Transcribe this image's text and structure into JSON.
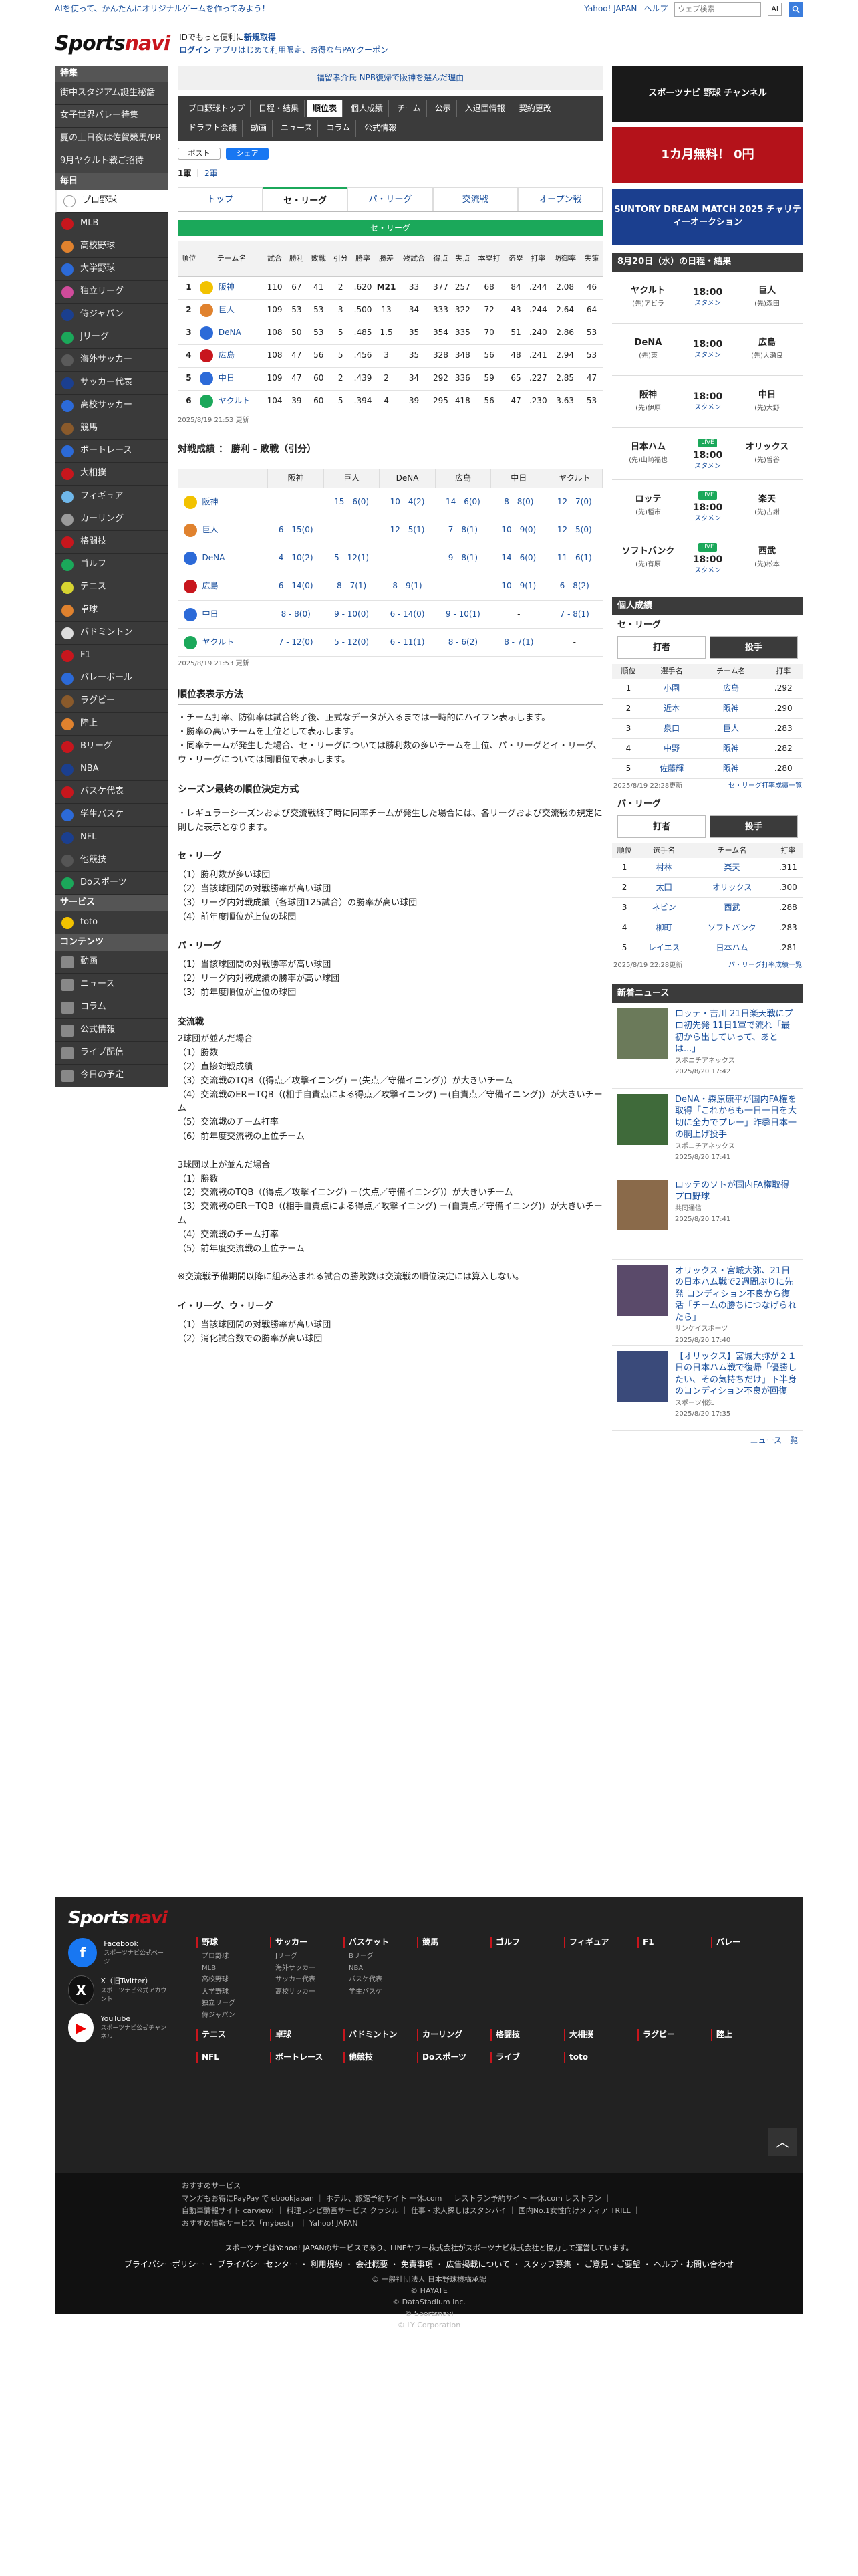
{
  "topbar": {
    "promo": "AIを使って、かんたんにオリジナルゲームを作ってみよう！",
    "links": [
      "Yahoo! JAPAN",
      "ヘルプ"
    ],
    "search_placeholder": "ウェブ検索",
    "search_label": "Ai"
  },
  "header": {
    "logo_a": "Sports",
    "logo_b": "navi",
    "line1a": "IDでもっと便利に",
    "line1b": "新規取得",
    "line2a": "ログイン",
    "line2b": "アプリはじめて利用限定、お得な与PAYクーポン"
  },
  "leftnav": {
    "feature_title": "特集",
    "features": [
      "街中スタジアム誕生秘話",
      "女子世界バレー特集",
      "夏の土日夜は佐賀競馬/PR",
      "9月ヤクルト戦ご招待"
    ],
    "daily_title": "毎日",
    "daily": [
      {
        "label": "プロ野球",
        "color": "#ffffff"
      },
      {
        "label": "MLB",
        "color": "#c8161d"
      },
      {
        "label": "高校野球",
        "color": "#e0822e"
      },
      {
        "label": "大学野球",
        "color": "#2c6ad8"
      },
      {
        "label": "独立リーグ",
        "color": "#d04b9b"
      },
      {
        "label": "侍ジャパン",
        "color": "#1b3f8f"
      },
      {
        "label": "Jリーグ",
        "color": "#1ba85a"
      },
      {
        "label": "海外サッカー",
        "color": "#5a5a5a"
      },
      {
        "label": "サッカー代表",
        "color": "#1b3f8f"
      },
      {
        "label": "高校サッカー",
        "color": "#2c6ad8"
      },
      {
        "label": "競馬",
        "color": "#8a5a2b"
      },
      {
        "label": "ボートレース",
        "color": "#2c6ad8"
      },
      {
        "label": "大相撲",
        "color": "#c8161d"
      },
      {
        "label": "フィギュア",
        "color": "#6fb7ea"
      },
      {
        "label": "カーリング",
        "color": "#9b9b9b"
      },
      {
        "label": "格闘技",
        "color": "#c8161d"
      },
      {
        "label": "ゴルフ",
        "color": "#1ba85a"
      },
      {
        "label": "テニス",
        "color": "#d7d431"
      },
      {
        "label": "卓球",
        "color": "#e0822e"
      },
      {
        "label": "バドミントン",
        "color": "#dddddd"
      },
      {
        "label": "F1",
        "color": "#c8161d"
      },
      {
        "label": "バレーボール",
        "color": "#2c6ad8"
      },
      {
        "label": "ラグビー",
        "color": "#8a5a2b"
      },
      {
        "label": "陸上",
        "color": "#e0822e"
      },
      {
        "label": "Bリーグ",
        "color": "#c8161d"
      },
      {
        "label": "NBA",
        "color": "#1b3f8f"
      },
      {
        "label": "バスケ代表",
        "color": "#c8161d"
      },
      {
        "label": "学生バスケ",
        "color": "#2c6ad8"
      },
      {
        "label": "NFL",
        "color": "#1b3f8f"
      },
      {
        "label": "他競技",
        "color": "#555555"
      },
      {
        "label": "Doスポーツ",
        "color": "#1ba85a"
      }
    ],
    "service_title": "サービス",
    "service": [
      "toto"
    ],
    "content_title": "コンテンツ",
    "content": [
      "動画",
      "ニュース",
      "コラム",
      "公式情報",
      "ライブ配信",
      "今日の予定"
    ]
  },
  "main": {
    "banner": "福留孝介氏 NPB復帰で阪神を選んだ理由",
    "menu": [
      "プロ野球トップ",
      "日程・結果",
      "順位表",
      "個人成績",
      "チーム",
      "公示",
      "入退団情報",
      "契約更改",
      "ドラフト会議",
      "動画",
      "ニュース",
      "コラム",
      "公式情報"
    ],
    "social_x": "ポスト",
    "social_fb": "シェア",
    "years_cur": "1軍",
    "years_other": "2軍",
    "tabs": [
      "トップ",
      "セ・リーグ",
      "パ・リーグ",
      "交流戦",
      "オープン戦"
    ],
    "league_label": "セ・リーグ",
    "stand_headers": [
      "順位",
      "チーム名",
      "試合",
      "勝利",
      "敗戦",
      "引分",
      "勝率",
      "勝差",
      "残試合",
      "得点",
      "失点",
      "本塁打",
      "盗塁",
      "打率",
      "防御率",
      "失策"
    ],
    "standings": [
      {
        "rank": "1",
        "team": "阪神",
        "color": "#f2c200",
        "vals": [
          "110",
          "67",
          "41",
          "2",
          ".620",
          "M21",
          "33",
          "377",
          "257",
          "68",
          "84",
          ".244",
          "2.08",
          "46"
        ]
      },
      {
        "rank": "2",
        "team": "巨人",
        "color": "#e0822e",
        "vals": [
          "109",
          "53",
          "53",
          "3",
          ".500",
          "13",
          "34",
          "333",
          "322",
          "72",
          "43",
          ".244",
          "2.64",
          "64"
        ]
      },
      {
        "rank": "3",
        "team": "DeNA",
        "color": "#2c6ad8",
        "vals": [
          "108",
          "50",
          "53",
          "5",
          ".485",
          "1.5",
          "35",
          "354",
          "335",
          "70",
          "51",
          ".240",
          "2.86",
          "53"
        ]
      },
      {
        "rank": "4",
        "team": "広島",
        "color": "#c8161d",
        "vals": [
          "108",
          "47",
          "56",
          "5",
          ".456",
          "3",
          "35",
          "328",
          "348",
          "56",
          "48",
          ".241",
          "2.94",
          "53"
        ]
      },
      {
        "rank": "5",
        "team": "中日",
        "color": "#2c6ad8",
        "vals": [
          "109",
          "47",
          "60",
          "2",
          ".439",
          "2",
          "34",
          "292",
          "336",
          "59",
          "65",
          ".227",
          "2.85",
          "47"
        ]
      },
      {
        "rank": "6",
        "team": "ヤクルト",
        "color": "#1ba85a",
        "vals": [
          "104",
          "39",
          "60",
          "5",
          ".394",
          "4",
          "39",
          "295",
          "418",
          "56",
          "47",
          ".230",
          "3.63",
          "53"
        ]
      }
    ],
    "updated1": "2025/8/19 21:53 更新",
    "vs_title": "対戦成績 ： 勝利 - 敗戦（引分）",
    "vs_headers": [
      "",
      "阪神",
      "巨人",
      "DeNA",
      "広島",
      "中日",
      "ヤクルト"
    ],
    "vs_rows": [
      {
        "team": "阪神",
        "color": "#f2c200",
        "vals": [
          "-",
          "15 - 6(0)",
          "10 - 4(2)",
          "14 - 6(0)",
          "8 - 8(0)",
          "12 - 7(0)"
        ]
      },
      {
        "team": "巨人",
        "color": "#e0822e",
        "vals": [
          "6 - 15(0)",
          "-",
          "12 - 5(1)",
          "7 - 8(1)",
          "10 - 9(0)",
          "12 - 5(0)"
        ]
      },
      {
        "team": "DeNA",
        "color": "#2c6ad8",
        "vals": [
          "4 - 10(2)",
          "5 - 12(1)",
          "-",
          "9 - 8(1)",
          "14 - 6(0)",
          "11 - 6(1)"
        ]
      },
      {
        "team": "広島",
        "color": "#c8161d",
        "vals": [
          "6 - 14(0)",
          "8 - 7(1)",
          "8 - 9(1)",
          "-",
          "10 - 9(1)",
          "6 - 8(2)"
        ]
      },
      {
        "team": "中日",
        "color": "#2c6ad8",
        "vals": [
          "8 - 8(0)",
          "9 - 10(0)",
          "6 - 14(0)",
          "9 - 10(1)",
          "-",
          "7 - 8(1)"
        ]
      },
      {
        "team": "ヤクルト",
        "color": "#1ba85a",
        "vals": [
          "7 - 12(0)",
          "5 - 12(0)",
          "6 - 11(1)",
          "8 - 6(2)",
          "8 - 7(1)",
          "-"
        ]
      }
    ],
    "updated2": "2025/8/19 21:53 更新",
    "rank_title": "順位表表示方法",
    "rank_text": [
      "・チーム打率、防御率は試合終了後、正式なデータが入るまでは一時的にハイフン表示します。",
      "・勝率の高いチームを上位として表示します。",
      "・同率チームが発生した場合、セ・リーグについては勝利数の多いチームを上位、パ・リーグとイ・リーグ、ウ・リーグについては同順位で表示します。"
    ],
    "season_title": "シーズン最終の順位決定方式",
    "season_text": "・レギュラーシーズンおよび交流戦終了時に同率チームが発生した場合には、各リーグおよび交流戦の規定に則した表示となります。",
    "ce_title": "セ・リーグ",
    "ce": [
      "（1）勝利数が多い球団",
      "（2）当該球団間の対戦勝率が高い球団",
      "（3）リーグ内対戦成績（各球団125試合）の勝率が高い球団",
      "（4）前年度順位が上位の球団"
    ],
    "pa_title": "パ・リーグ",
    "pa": [
      "（1）当該球団間の対戦勝率が高い球団",
      "（2）リーグ内対戦成績の勝率が高い球団",
      "（3）前年度順位が上位の球団"
    ],
    "kr_title": "交流戦",
    "kr1_title": "2球団が並んだ場合",
    "kr1": [
      "（1）勝数",
      "（2）直接対戦成績",
      "（3）交流戦のTQB（(得点／攻撃イニング) －(失点／守備イニング)）が大きいチーム",
      "（4）交流戦のER－TQB（(相手自責点による得点／攻撃イニング) －(自責点／守備イニング)）が大きいチーム",
      "（5）交流戦のチーム打率",
      "（6）前年度交流戦の上位チーム"
    ],
    "kr2_title": "3球団以上が並んだ場合",
    "kr2": [
      "（1）勝数",
      "（2）交流戦のTQB（(得点／攻撃イニング) －(失点／守備イニング)）が大きいチーム",
      "（3）交流戦のER－TQB（(相手自責点による得点／攻撃イニング) －(自責点／守備イニング)）が大きいチーム",
      "（4）交流戦のチーム打率",
      "（5）前年度交流戦の上位チーム"
    ],
    "kr_note": "※交流戦予備期間以降に組み込まれる試合の勝敗数は交流戦の順位決定には算入しない。",
    "iu_title": "イ・リーグ、ウ・リーグ",
    "iu": [
      "（1）当該球団間の対戦勝率が高い球団",
      "（2）消化試合数での勝率が高い球団"
    ]
  },
  "right": {
    "ad1": "スポーツナビ 野球 チャンネル",
    "ad2": "1カ月無料！ 0円",
    "ad3": "SUNTORY DREAM MATCH 2025 チャリティーオークション",
    "games_title": "8月20日（水）の日程・結果",
    "games": [
      {
        "h": "ヤクルト",
        "hp": "(先)アビラ",
        "a": "巨人",
        "ap": "(先)森田",
        "time": "18:00",
        "st": "スタメン",
        "live": false
      },
      {
        "h": "DeNA",
        "hp": "(先)東",
        "a": "広島",
        "ap": "(先)大瀬良",
        "time": "18:00",
        "st": "スタメン",
        "live": false
      },
      {
        "h": "阪神",
        "hp": "(先)伊原",
        "a": "中日",
        "ap": "(先)大野",
        "time": "18:00",
        "st": "スタメン",
        "live": false
      },
      {
        "h": "日本ハム",
        "hp": "(先)山崎福也",
        "a": "オリックス",
        "ap": "(先)曽谷",
        "time": "18:00",
        "st": "スタメン",
        "live": true
      },
      {
        "h": "ロッテ",
        "hp": "(先)種市",
        "a": "楽天",
        "ap": "(先)古謝",
        "time": "18:00",
        "st": "スタメン",
        "live": true
      },
      {
        "h": "ソフトバンク",
        "hp": "(先)有原",
        "a": "西武",
        "ap": "(先)松本",
        "time": "18:00",
        "st": "スタメン",
        "live": true
      }
    ],
    "ind_title": "個人成績",
    "ce_label": "セ・リーグ",
    "seg": [
      "打者",
      "投手"
    ],
    "ind_head": [
      "順位",
      "選手名",
      "チーム名",
      "打率"
    ],
    "ce_bat": [
      [
        "1",
        "小園",
        "広島",
        ".292"
      ],
      [
        "2",
        "近本",
        "阪神",
        ".290"
      ],
      [
        "3",
        "泉口",
        "巨人",
        ".283"
      ],
      [
        "4",
        "中野",
        "阪神",
        ".282"
      ],
      [
        "5",
        "佐藤輝",
        "阪神",
        ".280"
      ]
    ],
    "ce_upd": "2025/8/19 22:28更新",
    "ce_more": "セ・リーグ打率成績一覧",
    "pa_label": "パ・リーグ",
    "pa_bat": [
      [
        "1",
        "村林",
        "楽天",
        ".311"
      ],
      [
        "2",
        "太田",
        "オリックス",
        ".300"
      ],
      [
        "3",
        "ネビン",
        "西武",
        ".288"
      ],
      [
        "4",
        "柳町",
        "ソフトバンク",
        ".283"
      ],
      [
        "5",
        "レイエス",
        "日本ハム",
        ".281"
      ]
    ],
    "pa_upd": "2025/8/19 22:28更新",
    "pa_more": "パ・リーグ打率成績一覧",
    "news_title": "新着ニュース",
    "news": [
      {
        "t": "ロッテ・吉川 21日楽天戦にプロ初先発 11日1軍で流れ「最初から出していって、あとは...」",
        "s": "スポニチアネックス",
        "d": "2025/8/20 17:42"
      },
      {
        "t": "DeNA・森原康平が国内FA権を取得「これからも一日一日を大切に全力でプレー」昨季日本一の胴上げ投手",
        "s": "スポニチアネックス",
        "d": "2025/8/20 17:41"
      },
      {
        "t": "ロッテのソトが国内FA権取得 プロ野球",
        "s": "共同通信",
        "d": "2025/8/20 17:41"
      },
      {
        "t": "オリックス・宮城大弥、21日の日本ハム戦で2週間ぶりに先発 コンディション不良から復活「チームの勝ちにつなげられたら」",
        "s": "サンケイスポーツ",
        "d": "2025/8/20 17:40"
      },
      {
        "t": "【オリックス】宮城大弥が２１日の日本ハム戦で復帰「優勝したい、その気持ちだけ」下半身のコンディション不良が回復",
        "s": "スポーツ報知",
        "d": "2025/8/20 17:35"
      }
    ],
    "news_more": "ニュース一覧"
  },
  "footer": {
    "logo_a": "Sports",
    "logo_b": "navi",
    "soc": [
      {
        "n": "Facebook",
        "s": "スポーツナビ公式ページ"
      },
      {
        "n": "X（旧Twitter）",
        "s": "スポーツナビ公式アカウント"
      },
      {
        "n": "YouTube",
        "s": "スポーツナビ公式チャンネル"
      }
    ],
    "cols": [
      {
        "h": "野球",
        "i": [
          "プロ野球",
          "MLB",
          "高校野球",
          "大学野球",
          "独立リーグ",
          "侍ジャパン"
        ]
      },
      {
        "h": "サッカー",
        "i": [
          "Jリーグ",
          "海外サッカー",
          "サッカー代表",
          "高校サッカー"
        ]
      },
      {
        "h": "バスケット",
        "i": [
          "Bリーグ",
          "NBA",
          "バスケ代表",
          "学生バスケ"
        ]
      },
      {
        "h": "競馬",
        "i": []
      },
      {
        "h": "ゴルフ",
        "i": []
      },
      {
        "h": "フィギュア",
        "i": []
      },
      {
        "h": "F1",
        "i": []
      },
      {
        "h": "バレー",
        "i": []
      },
      {
        "h": "テニス",
        "i": []
      },
      {
        "h": "卓球",
        "i": []
      },
      {
        "h": "バドミントン",
        "i": []
      },
      {
        "h": "カーリング",
        "i": []
      },
      {
        "h": "格闘技",
        "i": []
      },
      {
        "h": "大相撲",
        "i": []
      },
      {
        "h": "ラグビー",
        "i": []
      },
      {
        "h": "陸上",
        "i": []
      },
      {
        "h": "NFL",
        "i": []
      },
      {
        "h": "ボートレース",
        "i": []
      },
      {
        "h": "他競技",
        "i": []
      },
      {
        "h": "Doスポーツ",
        "i": []
      },
      {
        "h": "ライブ",
        "i": []
      },
      {
        "h": "toto",
        "i": []
      }
    ],
    "osu_title": "おすすめサービス",
    "osu1": "マンガもお得にPayPay で ebookjapan ｜ ホテル、旅館予約サイト 一休.com ｜ レストラン予約サイト 一休.com レストラン ｜",
    "osu2": "自動車情報サイト carview! ｜ 料理レシピ動画サービス クラシル ｜ 仕事・求人探しはスタンバイ ｜ 国内No.1女性向けメディア TRILL ｜",
    "osu3": "おすすめ情報サービス「mybest」 ｜ Yahoo! JAPAN",
    "note": "スポーツナビはYahoo! JAPANのサービスであり、LINEヤフー株式会社がスポーツナビ株式会社と協力して運営しています。",
    "links": "プライバシーポリシー ・ プライバシーセンター ・ 利用規約 ・ 会社概要 ・ 免責事項 ・ 広告掲載について ・ スタッフ募集 ・ ご意見・ご要望 ・ ヘルプ・お問い合わせ",
    "copy": [
      "© 一般社団法人 日本野球機構承認",
      "© HAYATE",
      "© DataStadium Inc.",
      "© Sportsnavi",
      "© LY Corporation"
    ]
  }
}
